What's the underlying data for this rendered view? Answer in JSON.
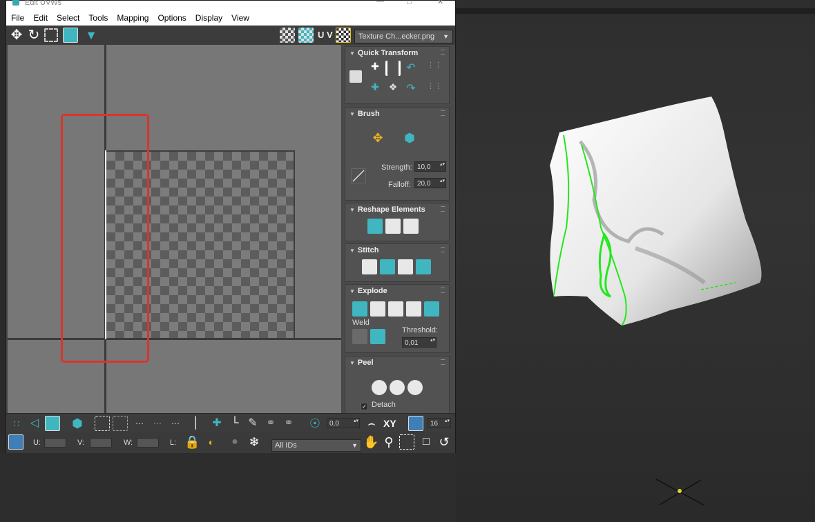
{
  "window": {
    "title": "Edit UVWs"
  },
  "menu": [
    "File",
    "Edit",
    "Select",
    "Tools",
    "Mapping",
    "Options",
    "Display",
    "View"
  ],
  "toolbar": {
    "uv_label": "U V",
    "texture_dropdown": "Texture Ch...ecker.png"
  },
  "panel": {
    "quick_transform": {
      "title": "Quick Transform"
    },
    "brush": {
      "title": "Brush",
      "strength_label": "Strength:",
      "strength_value": "10,0",
      "falloff_label": "Falloff:",
      "falloff_value": "20,0"
    },
    "reshape": {
      "title": "Reshape Elements"
    },
    "stitch": {
      "title": "Stitch"
    },
    "explode": {
      "title": "Explode",
      "weld_label": "Weld",
      "threshold_label": "Threshold:",
      "threshold_value": "0,01"
    },
    "peel": {
      "title": "Peel",
      "detach_label": "Detach"
    }
  },
  "bottom": {
    "spin_value": "0,0",
    "xy_label": "XY",
    "grid_value": "16",
    "u_label": "U:",
    "v_label": "V:",
    "w_label": "W:",
    "l_label": "L:",
    "ids_dropdown": "All IDs"
  },
  "colors": {
    "accent": "#3fb6c0",
    "highlight_box": "#d9352e",
    "seam_green": "#22e81c"
  }
}
